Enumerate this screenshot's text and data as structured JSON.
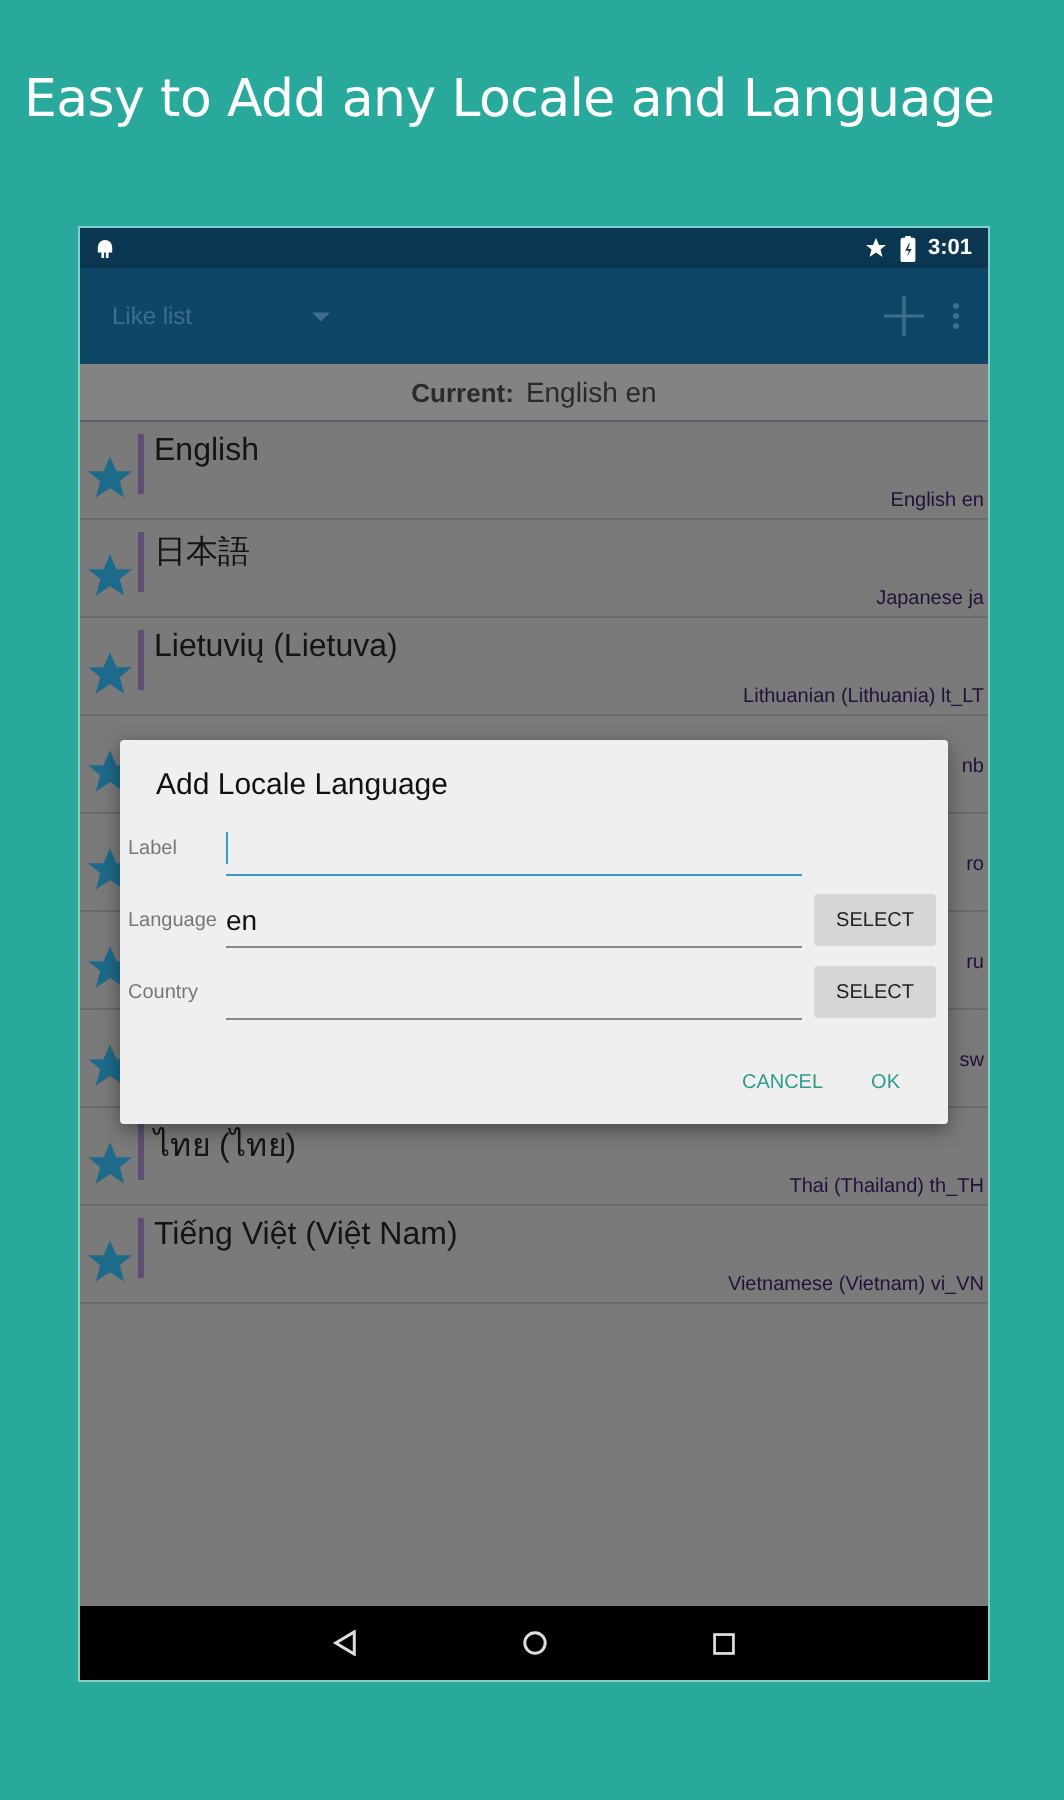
{
  "headline": "Easy to Add any Locale and Language",
  "status_bar": {
    "time": "3:01"
  },
  "toolbar": {
    "title": "Like list"
  },
  "current": {
    "label": "Current:",
    "value": "English en"
  },
  "rows": [
    {
      "kind": "full",
      "starred": true,
      "title": "English",
      "subtitle": "English en"
    },
    {
      "kind": "full",
      "starred": true,
      "title": "日本語",
      "subtitle": "Japanese ja"
    },
    {
      "kind": "full",
      "starred": true,
      "title": "Lietuvių (Lietuva)",
      "subtitle": "Lithuanian (Lithuania) lt_LT"
    },
    {
      "kind": "covered",
      "starred": true,
      "subtitle": "nb"
    },
    {
      "kind": "covered",
      "starred": true,
      "subtitle": "ro"
    },
    {
      "kind": "covered",
      "starred": true,
      "subtitle": "ru"
    },
    {
      "kind": "covered",
      "starred": true,
      "subtitle": "sw"
    },
    {
      "kind": "full",
      "starred": true,
      "title": "ไทย (ไทย)",
      "subtitle": "Thai (Thailand) th_TH"
    },
    {
      "kind": "full",
      "starred": true,
      "title": "Tiếng Việt (Việt Nam)",
      "subtitle": "Vietnamese (Vietnam) vi_VN"
    }
  ],
  "dialog": {
    "title": "Add Locale Language",
    "fields": [
      {
        "label": "Label",
        "focused": true
      },
      {
        "label": "Language",
        "value": "en",
        "focused": false,
        "button": "SELECT"
      },
      {
        "label": "Country",
        "focused": false,
        "button": "SELECT"
      }
    ],
    "actions": [
      "CANCEL",
      "OK"
    ]
  }
}
